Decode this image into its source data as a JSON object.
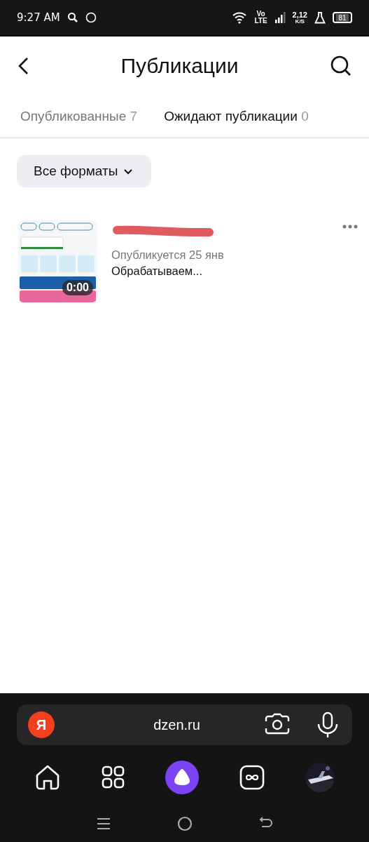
{
  "status_bar": {
    "time": "9:27 AM",
    "network": "Vo",
    "network_sub": "LTE",
    "speed": "2,12",
    "speed_unit": "K/S",
    "battery": "81"
  },
  "header": {
    "title": "Публикации"
  },
  "tabs": [
    {
      "label": "Опубликованные",
      "count": "7",
      "selected": false
    },
    {
      "label": "Ожидают публикации",
      "count": "0",
      "selected": true
    }
  ],
  "filter": {
    "label": "Все форматы"
  },
  "publications": [
    {
      "duration": "0:00",
      "title_redacted": true,
      "schedule": "Опубликуется 25 янв",
      "status": "Обрабатываем..."
    }
  ],
  "browser_bar": {
    "logo": "Я",
    "url": "dzen.ru"
  }
}
